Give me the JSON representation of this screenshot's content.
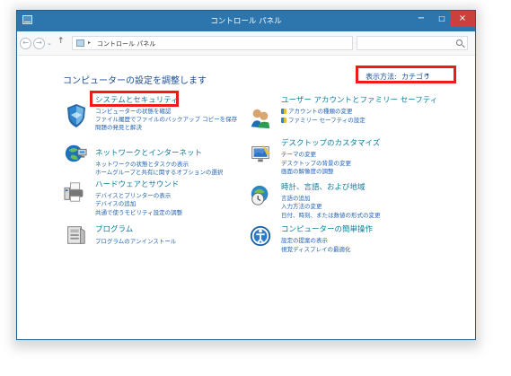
{
  "window": {
    "title": "コントロール パネル"
  },
  "title_buttons": {
    "minimize": "−",
    "maximize": "□",
    "close": "×"
  },
  "navigation": {
    "back": "←",
    "forward": "→",
    "recent": "⌄",
    "up": "↑",
    "address_arrow": "▸",
    "address_path": "コントロール パネル",
    "address_dropdown": "⌄",
    "refresh": "↻",
    "search_placeholder": ""
  },
  "page": {
    "heading": "コンピューターの設定を調整します",
    "view_by": {
      "label": "表示方法:",
      "value": "カテゴリ",
      "caret": "▾"
    }
  },
  "categories": [
    {
      "title": "システムとセキュリティ",
      "links": [
        "コンピューターの状態を確認",
        "ファイル履歴でファイルのバックアップ コピーを保存",
        "問題の発見と解決"
      ],
      "icon": "shield-icon"
    },
    {
      "title": "ネットワークとインターネット",
      "links": [
        "ネットワークの状態とタスクの表示",
        "ホームグループと共有に関するオプションの選択"
      ],
      "icon": "network-icon"
    },
    {
      "title": "ハードウェアとサウンド",
      "links": [
        "デバイスとプリンターの表示",
        "デバイスの追加",
        "共通で使うモビリティ設定の調整"
      ],
      "icon": "printer-icon"
    },
    {
      "title": "プログラム",
      "links": [
        "プログラムのアンインストール"
      ],
      "icon": "programs-icon"
    },
    {
      "title": "ユーザー アカウントとファミリー セーフティ",
      "links": [
        "アカウントの種類の変更",
        "ファミリー セーフティの設定"
      ],
      "icon": "users-icon"
    },
    {
      "title": "デスクトップのカスタマイズ",
      "links": [
        "テーマの変更",
        "デスクトップの背景の変更",
        "画面の解像度の調整"
      ],
      "icon": "desktop-icon"
    },
    {
      "title": "時計、言語、および地域",
      "links": [
        "言語の追加",
        "入力方法の変更",
        "日付、時刻、または数値の形式の変更"
      ],
      "icon": "globe-clock-icon"
    },
    {
      "title": "コンピューターの簡単操作",
      "links": [
        "設定の提案の表示",
        "視覚ディスプレイの最適化"
      ],
      "icon": "accessibility-icon"
    }
  ],
  "colors": {
    "titlebar": "#2d76ad",
    "close_button": "#c9413d",
    "heading": "#1d4f93",
    "category_title": "#0b7d9f",
    "link": "#2465b5",
    "highlight": "#ef1a1a"
  }
}
